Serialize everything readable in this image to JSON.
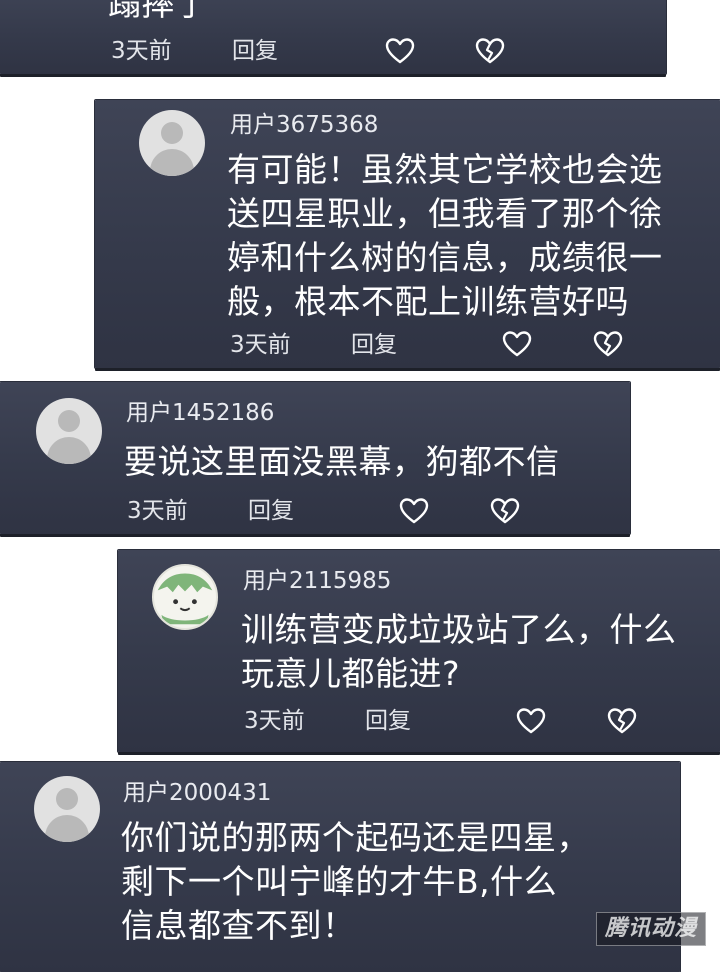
{
  "comments": [
    {
      "text_lines": [
        "蹋摔了"
      ],
      "time": "3天前",
      "reply_label": "回复"
    },
    {
      "user": "用户3675368",
      "text_lines": [
        "有可能！虽然其它学校也会选",
        "送四星职业，但我看了那个徐",
        "婷和什么树的信息，成绩很一",
        "般，根本不配上训练营好吗"
      ],
      "time": "3天前",
      "reply_label": "回复"
    },
    {
      "user": "用户1452186",
      "text_lines": [
        "要说这里面没黑幕，狗都不信"
      ],
      "time": "3天前",
      "reply_label": "回复"
    },
    {
      "user": "用户2115985",
      "text_lines": [
        "训练营变成垃圾站了么，什么",
        "玩意儿都能进?"
      ],
      "time": "3天前",
      "reply_label": "回复"
    },
    {
      "user": "用户2000431",
      "text_lines": [
        "你们说的那两个起码还是四星，",
        "剩下一个叫宁峰的才牛B,什么",
        "信息都查不到！"
      ]
    }
  ],
  "icons": {
    "like": "heart-outline-icon",
    "dislike": "broken-heart-icon"
  },
  "watermark": "腾讯动漫",
  "colors": {
    "card_bg": "#3a3f50",
    "text": "#ffffff",
    "avatar": "#e1e1e1"
  }
}
